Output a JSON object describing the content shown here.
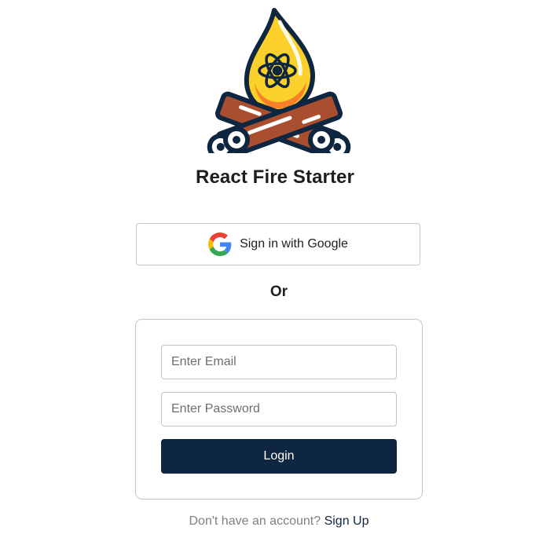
{
  "app": {
    "title": "React Fire Starter",
    "logo_icon": "campfire-react-logo-icon"
  },
  "google_signin": {
    "label": "Sign in with Google",
    "icon": "google-g-icon"
  },
  "divider": {
    "text": "Or"
  },
  "login_form": {
    "email_placeholder": "Enter Email",
    "email_value": "",
    "password_placeholder": "Enter Password",
    "password_value": "",
    "submit_label": "Login"
  },
  "signup": {
    "prompt": "Don't have an account?",
    "link_label": "Sign Up"
  },
  "colors": {
    "primary": "#0f2640",
    "border": "#c4c4c4",
    "muted_text": "#808080",
    "flame_yellow": "#fcd02b",
    "flame_orange": "#f8802a",
    "log_brown": "#a94e2e"
  }
}
